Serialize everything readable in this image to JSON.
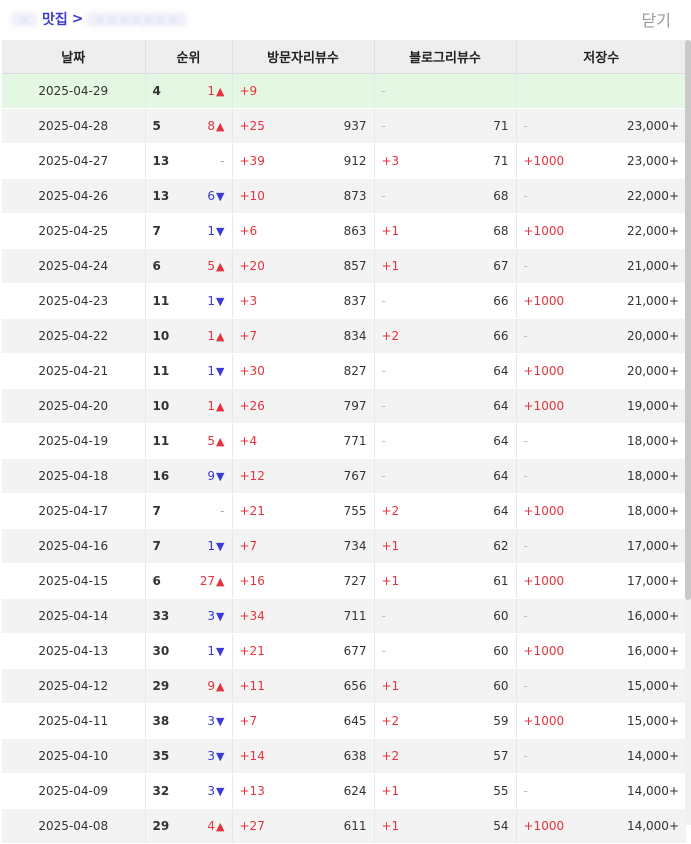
{
  "header": {
    "breadcrumb_region": "○○",
    "breadcrumb_category": "맛집",
    "breadcrumb_separator": ">",
    "breadcrumb_place": "○○○○○○○○",
    "close_label": "닫기"
  },
  "table": {
    "columns": [
      "날짜",
      "순위",
      "방문자리뷰수",
      "블로그리뷰수",
      "저장수"
    ],
    "rows": [
      {
        "date": "2025-04-29",
        "rank": "4",
        "change": "1",
        "dir": "up",
        "visit_delta": "+9",
        "visit": "",
        "blog_delta": "-",
        "blog": "",
        "save_delta": "",
        "save": "",
        "highlight": true
      },
      {
        "date": "2025-04-28",
        "rank": "5",
        "change": "8",
        "dir": "up",
        "visit_delta": "+25",
        "visit": "937",
        "blog_delta": "-",
        "blog": "71",
        "save_delta": "-",
        "save": "23,000+"
      },
      {
        "date": "2025-04-27",
        "rank": "13",
        "change": "-",
        "dir": "none",
        "visit_delta": "+39",
        "visit": "912",
        "blog_delta": "+3",
        "blog": "71",
        "save_delta": "+1000",
        "save": "23,000+"
      },
      {
        "date": "2025-04-26",
        "rank": "13",
        "change": "6",
        "dir": "down",
        "visit_delta": "+10",
        "visit": "873",
        "blog_delta": "-",
        "blog": "68",
        "save_delta": "-",
        "save": "22,000+"
      },
      {
        "date": "2025-04-25",
        "rank": "7",
        "change": "1",
        "dir": "down",
        "visit_delta": "+6",
        "visit": "863",
        "blog_delta": "+1",
        "blog": "68",
        "save_delta": "+1000",
        "save": "22,000+"
      },
      {
        "date": "2025-04-24",
        "rank": "6",
        "change": "5",
        "dir": "up",
        "visit_delta": "+20",
        "visit": "857",
        "blog_delta": "+1",
        "blog": "67",
        "save_delta": "-",
        "save": "21,000+"
      },
      {
        "date": "2025-04-23",
        "rank": "11",
        "change": "1",
        "dir": "down",
        "visit_delta": "+3",
        "visit": "837",
        "blog_delta": "-",
        "blog": "66",
        "save_delta": "+1000",
        "save": "21,000+"
      },
      {
        "date": "2025-04-22",
        "rank": "10",
        "change": "1",
        "dir": "up",
        "visit_delta": "+7",
        "visit": "834",
        "blog_delta": "+2",
        "blog": "66",
        "save_delta": "-",
        "save": "20,000+"
      },
      {
        "date": "2025-04-21",
        "rank": "11",
        "change": "1",
        "dir": "down",
        "visit_delta": "+30",
        "visit": "827",
        "blog_delta": "-",
        "blog": "64",
        "save_delta": "+1000",
        "save": "20,000+"
      },
      {
        "date": "2025-04-20",
        "rank": "10",
        "change": "1",
        "dir": "up",
        "visit_delta": "+26",
        "visit": "797",
        "blog_delta": "-",
        "blog": "64",
        "save_delta": "+1000",
        "save": "19,000+"
      },
      {
        "date": "2025-04-19",
        "rank": "11",
        "change": "5",
        "dir": "up",
        "visit_delta": "+4",
        "visit": "771",
        "blog_delta": "-",
        "blog": "64",
        "save_delta": "-",
        "save": "18,000+"
      },
      {
        "date": "2025-04-18",
        "rank": "16",
        "change": "9",
        "dir": "down",
        "visit_delta": "+12",
        "visit": "767",
        "blog_delta": "-",
        "blog": "64",
        "save_delta": "-",
        "save": "18,000+"
      },
      {
        "date": "2025-04-17",
        "rank": "7",
        "change": "-",
        "dir": "none",
        "visit_delta": "+21",
        "visit": "755",
        "blog_delta": "+2",
        "blog": "64",
        "save_delta": "+1000",
        "save": "18,000+"
      },
      {
        "date": "2025-04-16",
        "rank": "7",
        "change": "1",
        "dir": "down",
        "visit_delta": "+7",
        "visit": "734",
        "blog_delta": "+1",
        "blog": "62",
        "save_delta": "-",
        "save": "17,000+"
      },
      {
        "date": "2025-04-15",
        "rank": "6",
        "change": "27",
        "dir": "up",
        "visit_delta": "+16",
        "visit": "727",
        "blog_delta": "+1",
        "blog": "61",
        "save_delta": "+1000",
        "save": "17,000+"
      },
      {
        "date": "2025-04-14",
        "rank": "33",
        "change": "3",
        "dir": "down",
        "visit_delta": "+34",
        "visit": "711",
        "blog_delta": "-",
        "blog": "60",
        "save_delta": "-",
        "save": "16,000+"
      },
      {
        "date": "2025-04-13",
        "rank": "30",
        "change": "1",
        "dir": "down",
        "visit_delta": "+21",
        "visit": "677",
        "blog_delta": "-",
        "blog": "60",
        "save_delta": "+1000",
        "save": "16,000+"
      },
      {
        "date": "2025-04-12",
        "rank": "29",
        "change": "9",
        "dir": "up",
        "visit_delta": "+11",
        "visit": "656",
        "blog_delta": "+1",
        "blog": "60",
        "save_delta": "-",
        "save": "15,000+"
      },
      {
        "date": "2025-04-11",
        "rank": "38",
        "change": "3",
        "dir": "down",
        "visit_delta": "+7",
        "visit": "645",
        "blog_delta": "+2",
        "blog": "59",
        "save_delta": "+1000",
        "save": "15,000+"
      },
      {
        "date": "2025-04-10",
        "rank": "35",
        "change": "3",
        "dir": "down",
        "visit_delta": "+14",
        "visit": "638",
        "blog_delta": "+2",
        "blog": "57",
        "save_delta": "-",
        "save": "14,000+"
      },
      {
        "date": "2025-04-09",
        "rank": "32",
        "change": "3",
        "dir": "down",
        "visit_delta": "+13",
        "visit": "624",
        "blog_delta": "+1",
        "blog": "55",
        "save_delta": "-",
        "save": "14,000+"
      },
      {
        "date": "2025-04-08",
        "rank": "29",
        "change": "4",
        "dir": "up",
        "visit_delta": "+27",
        "visit": "611",
        "blog_delta": "+1",
        "blog": "54",
        "save_delta": "+1000",
        "save": "14,000+"
      }
    ]
  },
  "colors": {
    "up": "#e4343e",
    "down": "#3a3ad6",
    "highlight_row": "#e3f7e3",
    "header_bg": "#eeeeee"
  },
  "icons": {
    "up": "triangle-up-icon",
    "down": "triangle-down-icon"
  },
  "scroll": {
    "position_fraction": 0.0
  }
}
